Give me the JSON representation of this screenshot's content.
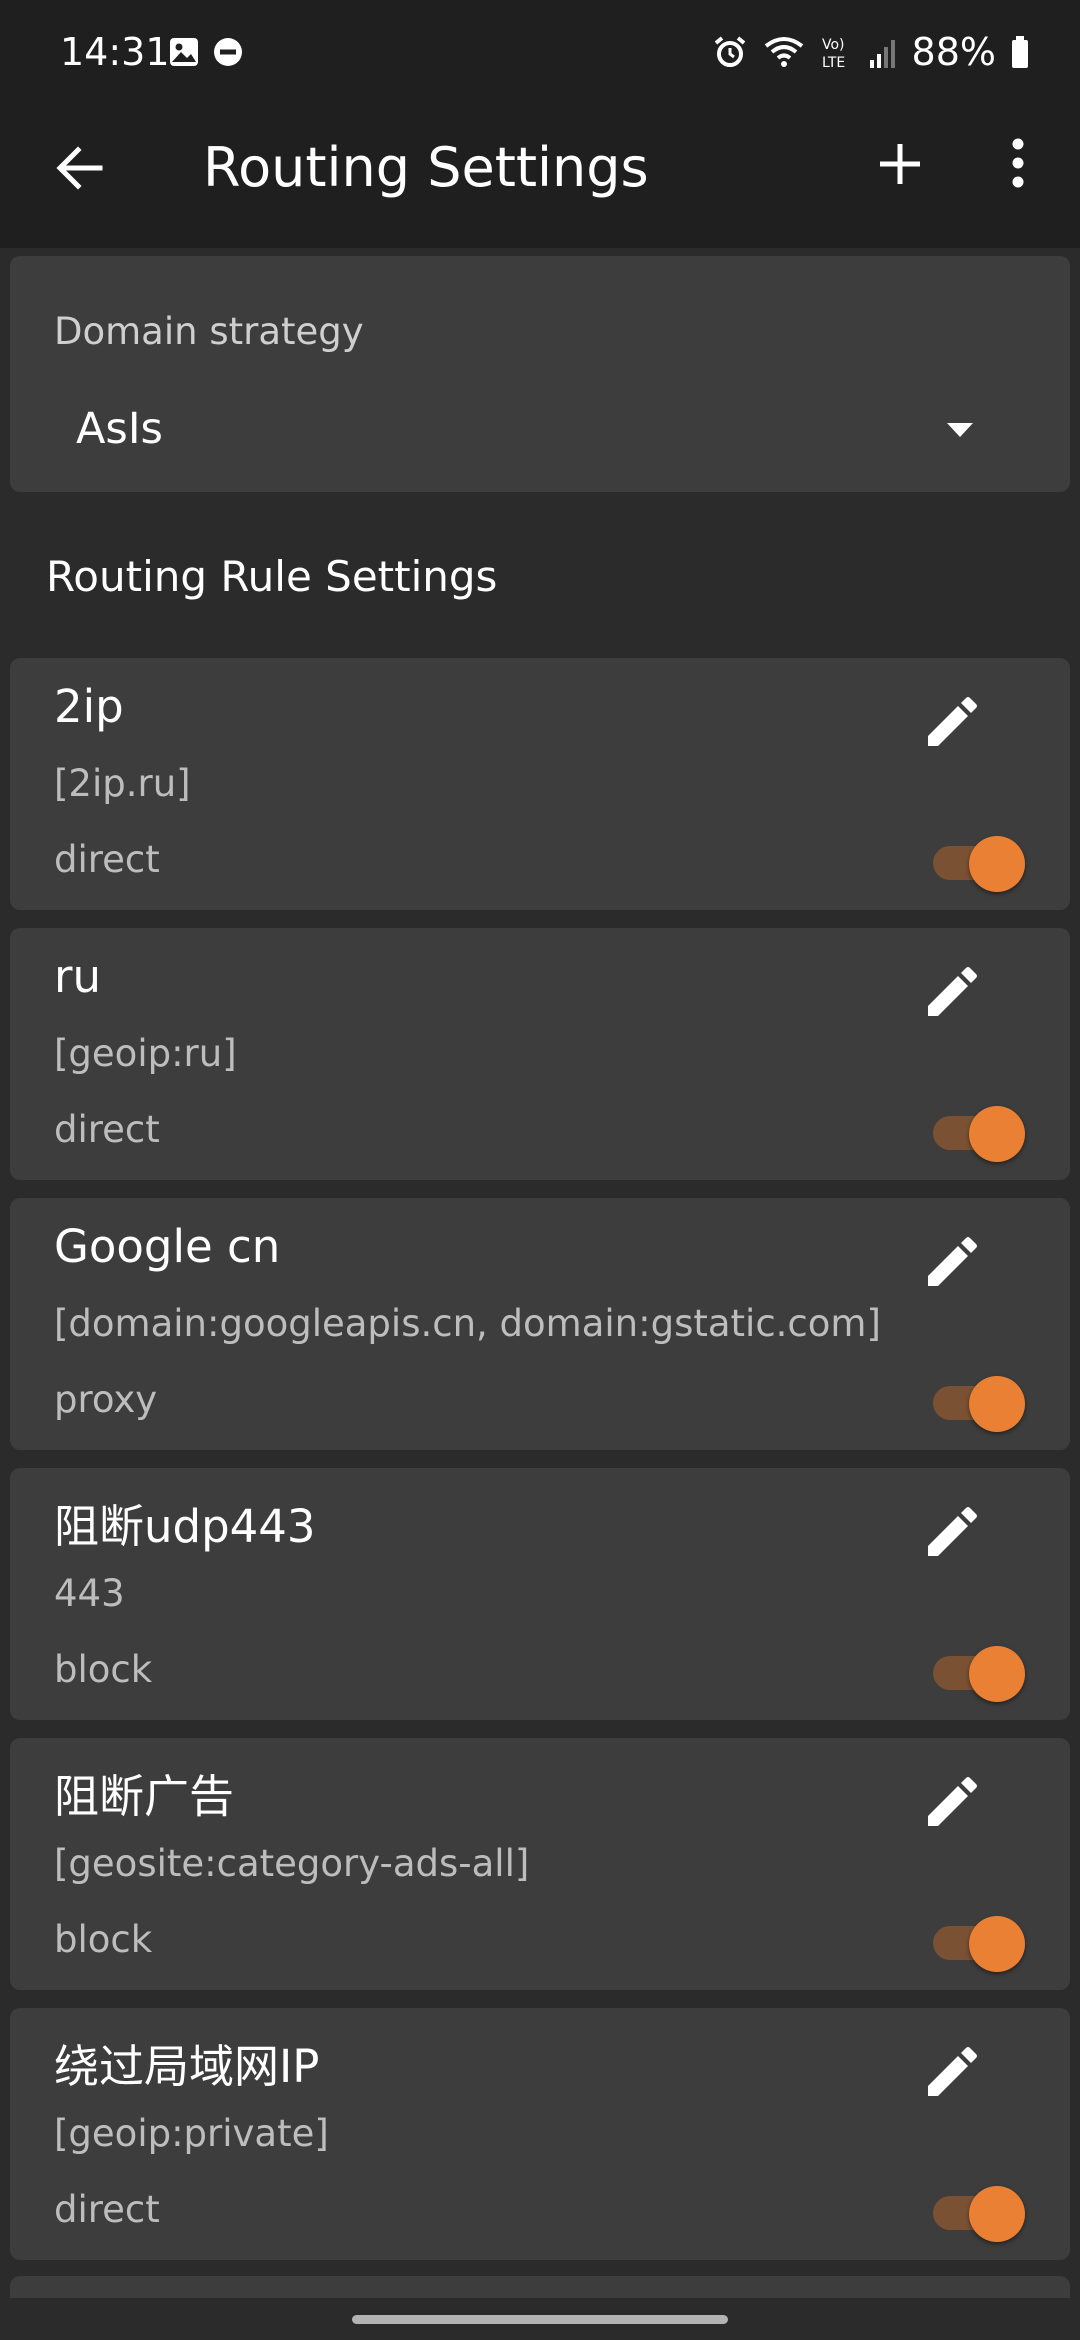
{
  "status_bar": {
    "time": "14:31",
    "battery": "88%",
    "left_icons": [
      "image-icon",
      "do-not-disturb-icon"
    ],
    "right_icons": [
      "alarm-icon",
      "wifi-icon",
      "volte-icon",
      "signal-icon",
      "battery-icon"
    ]
  },
  "app_bar": {
    "title": "Routing Settings",
    "back_icon": "arrow-back-icon",
    "add_icon": "plus-icon",
    "menu_icon": "more-vert-icon"
  },
  "domain_strategy": {
    "label": "Domain strategy",
    "value": "AsIs"
  },
  "section_title": "Routing Rule Settings",
  "rules": [
    {
      "title": "2ip",
      "domains": "[2ip.ru]",
      "outbound": "direct",
      "enabled": true
    },
    {
      "title": "ru",
      "domains": "[geoip:ru]",
      "outbound": "direct",
      "enabled": true
    },
    {
      "title": "Google cn",
      "domains": "[domain:googleapis.cn, domain:gstatic.com]",
      "outbound": "proxy",
      "enabled": true
    },
    {
      "title": "阻断udp443",
      "domains": "443",
      "outbound": "block",
      "enabled": true
    },
    {
      "title": "阻断广告",
      "domains": "[geosite:category-ads-all]",
      "outbound": "block",
      "enabled": true
    },
    {
      "title": "绕过局域网IP",
      "domains": "[geoip:private]",
      "outbound": "direct",
      "enabled": true
    }
  ],
  "colors": {
    "background": "#2b2b2b",
    "bar": "#1f1f1f",
    "card": "#3d3d3d",
    "accent": "#ea8034",
    "toggle_track": "#7a5133"
  }
}
